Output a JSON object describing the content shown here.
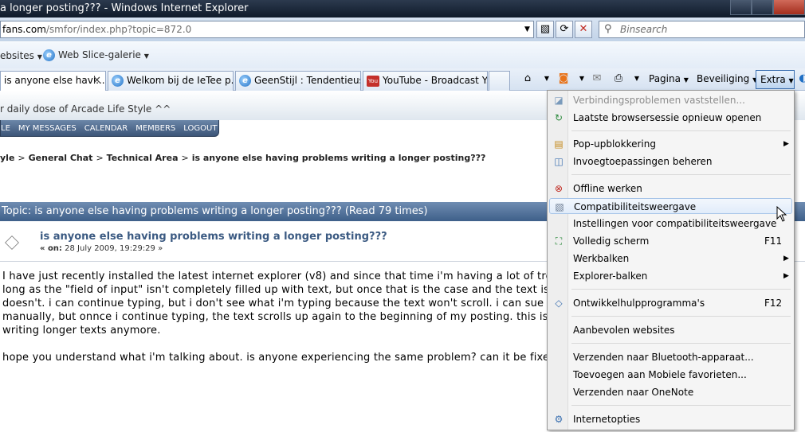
{
  "window": {
    "title": "a longer posting??? - Windows Internet Explorer"
  },
  "address": {
    "domain": "fans.com",
    "path": "/smfor/index.php?topic=872.0",
    "search_placeholder": "Binsearch"
  },
  "favorites": {
    "items": [
      {
        "label": "ebsites"
      },
      {
        "label": "Web Slice-galerie"
      }
    ]
  },
  "tabs": [
    {
      "label": "is anyone else havi..."
    },
    {
      "label": "Welkom bij de IeTee p..."
    },
    {
      "label": "GeenStijl : Tendentieus..."
    },
    {
      "label": "YouTube - Broadcast Y..."
    }
  ],
  "command_bar": {
    "pagina": "Pagina",
    "beveiliging": "Beveiliging",
    "extra": "Extra"
  },
  "page": {
    "tagline": "r daily dose of Arcade Life Style ^^",
    "nav": [
      "LE",
      "MY MESSAGES",
      "CALENDAR",
      "MEMBERS",
      "LOGOUT"
    ],
    "breadcrumbs": [
      "yle",
      "General Chat",
      "Technical Area",
      "is anyone else having problems writing a longer posting???"
    ],
    "topic_bar": "Topic: is anyone else having problems writing a longer posting???  (Read 79 times)",
    "post_title": "is anyone else having problems writing a longer posting???",
    "post_date_prefix": "« on:",
    "post_date": "28 July 2009, 19:29:29 »",
    "body_lines": [
      "I have just recently installed the latest internet explorer (v8) and since that time i'm having a lot of tro",
      "long as the \"field of input\" isn't completely filled up with text, but once that is the case and the text is",
      "doesn't. i can continue typing, but i don't see what i'm typing because the text won't scroll. i can sue",
      "manually, but onnce i continue typing, the text scrolls up again to the beginning of my posting. this is",
      "writing longer texts anymore.",
      "hope you understand what i'm talking about. is anyone experiencing the same problem? can it be fixed?"
    ]
  },
  "menu": {
    "items": [
      {
        "label": "Verbindingsproblemen vaststellen...",
        "icon": "diagnose-icon"
      },
      {
        "label": "Laatste browsersessie opnieuw openen",
        "icon": "reopen-icon"
      },
      {
        "label": "Pop-upblokkering",
        "icon": "popup-icon"
      },
      {
        "label": "Invoegtoepassingen beheren",
        "icon": "addons-icon"
      },
      {
        "label": "Offline werken",
        "icon": "offline-icon"
      },
      {
        "label": "Compatibiliteitsweergave",
        "icon": "compat-icon"
      },
      {
        "label": "Instellingen voor compatibiliteitsweergave",
        "icon": ""
      },
      {
        "label": "Volledig scherm",
        "shortcut": "F11",
        "icon": "fullscreen-icon"
      },
      {
        "label": "Werkbalken",
        "icon": ""
      },
      {
        "label": "Explorer-balken",
        "icon": ""
      },
      {
        "label": "Ontwikkelhulpprogramma's",
        "shortcut": "F12",
        "icon": "devtools-icon"
      },
      {
        "label": "Aanbevolen websites",
        "icon": ""
      },
      {
        "label": "Verzenden naar Bluetooth-apparaat...",
        "icon": ""
      },
      {
        "label": "Toevoegen aan Mobiele favorieten...",
        "icon": ""
      },
      {
        "label": "Verzenden naar OneNote",
        "icon": ""
      },
      {
        "label": "Internetopties",
        "icon": "options-icon"
      }
    ]
  }
}
